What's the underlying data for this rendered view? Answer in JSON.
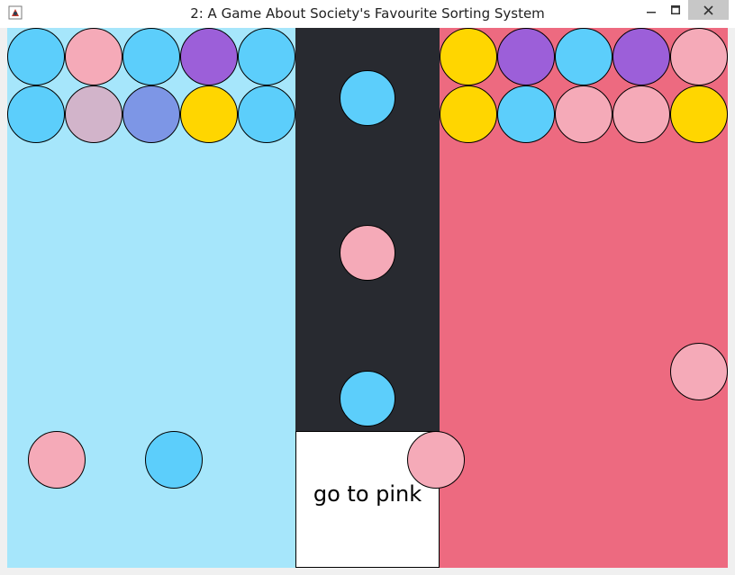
{
  "window": {
    "title": "2: A Game About Society's Favourite Sorting System",
    "icons": {
      "app": "java-app-icon",
      "minimize": "minimize-icon",
      "maximize": "maximize-icon",
      "close": "close-icon"
    }
  },
  "colors": {
    "blue_zone": "#a6e6fb",
    "dark_lane": "#282a30",
    "pink_zone": "#ed6a80",
    "ball_blue": "#5ccefb",
    "ball_pink": "#f5aab8",
    "ball_purple": "#9c5fd9",
    "ball_yellow": "#ffd600",
    "ball_mauve": "#d2b4ca",
    "ball_periwinkle": "#7d96e6"
  },
  "instruction": {
    "text": "go to pink"
  },
  "balls": {
    "blue_sorted": [
      "blue",
      "pink",
      "blue",
      "purple",
      "blue",
      "blue",
      "mauve",
      "periwinkle",
      "yellow",
      "blue"
    ],
    "pink_sorted": [
      "yellow",
      "purple",
      "blue",
      "purple",
      "pink",
      "yellow",
      "blue",
      "pink",
      "pink",
      "yellow"
    ],
    "lane_queue": [
      "blue",
      "pink",
      "blue"
    ],
    "loose": [
      "pink",
      "blue",
      "pink",
      "pink"
    ]
  }
}
